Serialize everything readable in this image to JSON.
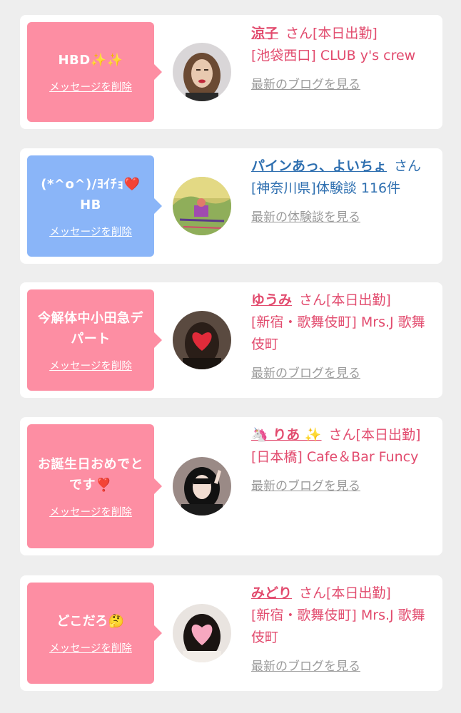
{
  "delete_label": "メッセージを削除",
  "colors": {
    "pink_bubble": "#fd8ea3",
    "blue_bubble": "#8ab5f8",
    "pink_text": "#e24b6e",
    "blue_text": "#2e6fb0",
    "link_gray": "#9a9a9a"
  },
  "items": [
    {
      "theme": "pink",
      "message": "HBD✨✨",
      "name": "涼子",
      "suffix": "さん[本日出勤]",
      "detail": "[池袋西口] CLUB y's crew",
      "latest": "最新のブログを見る",
      "avatar_icon": "woman-photo-avatar"
    },
    {
      "theme": "blue",
      "message": "(*^o^)/ﾖｲﾁｮ❤️ HB",
      "name": "パインあっ、よいちょ",
      "suffix": "さん",
      "detail": "[神奈川県]体験談 116件",
      "latest": "最新の体験談を見る",
      "avatar_icon": "drawing-avatar"
    },
    {
      "theme": "pink",
      "message": "今解体中小田急デパート",
      "name": "ゆうみ",
      "suffix": "さん[本日出勤]",
      "detail": "[新宿・歌舞伎町] Mrs.J 歌舞伎町",
      "latest": "最新のブログを見る",
      "avatar_icon": "woman-heart-face-avatar"
    },
    {
      "theme": "pink",
      "message": "お誕生日おめでとです❣️",
      "name": "🦄 りあ ✨",
      "suffix": "さん[本日出勤]",
      "detail": "[日本橋] Cafe＆Bar Funcy",
      "latest": "最新のブログを見る",
      "avatar_icon": "woman-peace-avatar"
    },
    {
      "theme": "pink",
      "message": "どこだろ🤔",
      "name": "みどり",
      "suffix": "さん[本日出勤]",
      "detail": "[新宿・歌舞伎町] Mrs.J 歌舞伎町",
      "latest": "最新のブログを見る",
      "avatar_icon": "woman-heart-face-avatar"
    }
  ]
}
